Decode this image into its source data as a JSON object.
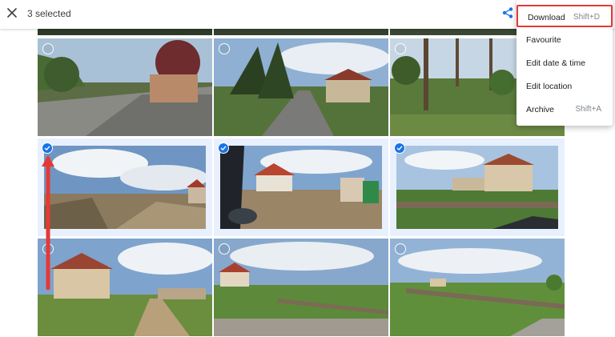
{
  "header": {
    "close_icon": "close-icon",
    "selected_text": "3 selected",
    "share_icon": "share-icon"
  },
  "menu": {
    "items": [
      {
        "label": "Download",
        "shortcut": "Shift+D",
        "highlighted": true
      },
      {
        "label": "Favourite",
        "shortcut": ""
      },
      {
        "label": "Edit date & time",
        "shortcut": ""
      },
      {
        "label": "Edit location",
        "shortcut": ""
      },
      {
        "label": "Archive",
        "shortcut": "Shift+A"
      }
    ]
  },
  "grid": {
    "rows": 3,
    "columns": 3,
    "photos": [
      {
        "scene": "street-with-trees",
        "selected": false
      },
      {
        "scene": "road-with-pines",
        "selected": false
      },
      {
        "scene": "trees-on-hill",
        "selected": false
      },
      {
        "scene": "construction-site-dirt",
        "selected": true
      },
      {
        "scene": "construction-site-car-window",
        "selected": true
      },
      {
        "scene": "railway-with-building",
        "selected": true
      },
      {
        "scene": "dirt-road-house",
        "selected": false
      },
      {
        "scene": "field-houses",
        "selected": false
      },
      {
        "scene": "field-railway",
        "selected": false
      }
    ]
  },
  "annotation": {
    "arrow_color": "#e53935"
  },
  "colors": {
    "accent": "#1a73e8",
    "highlight": "#e53935",
    "selected_tile_bg": "#e8f0fe"
  }
}
